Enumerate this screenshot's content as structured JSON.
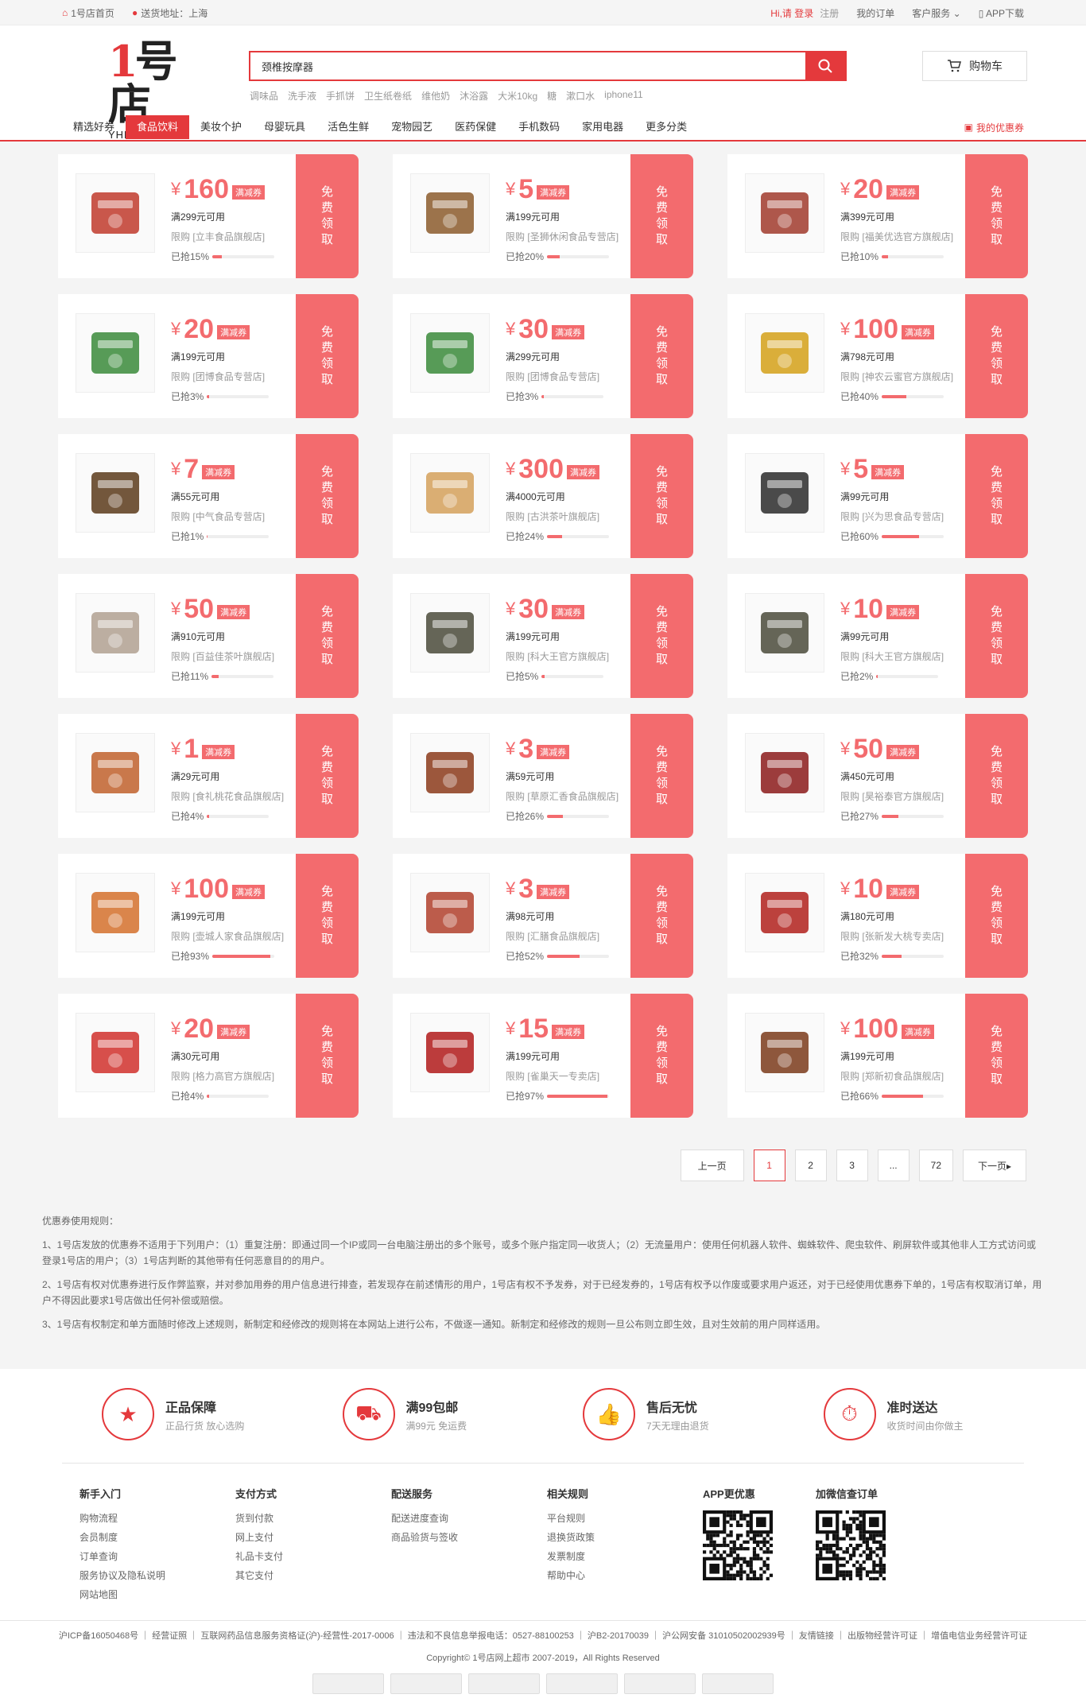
{
  "topbar": {
    "home": "1号店首页",
    "address_label": "送货地址：上海",
    "greeting": "Hi,请 登录",
    "register": "注册",
    "my_orders": "我的订单",
    "service": "客户服务",
    "app": "APP下载"
  },
  "header": {
    "logo_text": "YHD.COM",
    "search_value": "颈椎按摩器",
    "hotwords": [
      "调味品",
      "洗手液",
      "手抓饼",
      "卫生纸卷纸",
      "维他奶",
      "沐浴露",
      "大米10kg",
      "糖",
      "漱口水",
      "iphone11"
    ],
    "cart": "购物车"
  },
  "nav": {
    "items": [
      "精选好券",
      "食品饮料",
      "美妆个护",
      "母婴玩具",
      "活色生鲜",
      "宠物园艺",
      "医药保健",
      "手机数码",
      "家用电器",
      "更多分类"
    ],
    "my_coupons": "我的优惠券"
  },
  "coupon_common": {
    "yen": "¥",
    "tag": "满减券",
    "get_label": [
      "免",
      "费",
      "领",
      "取"
    ],
    "limit_prefix": "限购"
  },
  "coupons": [
    {
      "amount": "160",
      "cond": "满299元可用",
      "store": "[立丰食品旗舰店]",
      "progress": 15,
      "taken": "已抢15%",
      "color": "#c0392b"
    },
    {
      "amount": "5",
      "cond": "满199元可用",
      "store": "[圣狮休闲食品专营店]",
      "progress": 20,
      "taken": "已抢20%",
      "color": "#8b5a2b"
    },
    {
      "amount": "20",
      "cond": "满399元可用",
      "store": "[福美优选官方旗舰店]",
      "progress": 10,
      "taken": "已抢10%",
      "color": "#a0392b"
    },
    {
      "amount": "20",
      "cond": "满199元可用",
      "store": "[团博食品专营店]",
      "progress": 3,
      "taken": "已抢3%",
      "color": "#3a8a3a"
    },
    {
      "amount": "30",
      "cond": "满299元可用",
      "store": "[团博食品专营店]",
      "progress": 3,
      "taken": "已抢3%",
      "color": "#3a8a3a"
    },
    {
      "amount": "100",
      "cond": "满798元可用",
      "store": "[神农云蜜官方旗舰店]",
      "progress": 40,
      "taken": "已抢40%",
      "color": "#d4a017"
    },
    {
      "amount": "7",
      "cond": "满55元可用",
      "store": "[中气食品专营店]",
      "progress": 1,
      "taken": "已抢1%",
      "color": "#5a3a1a"
    },
    {
      "amount": "300",
      "cond": "满4000元可用",
      "store": "[古洪茶叶旗舰店]",
      "progress": 24,
      "taken": "已抢24%",
      "color": "#d4a05a"
    },
    {
      "amount": "5",
      "cond": "满99元可用",
      "store": "[兴为思食品专营店]",
      "progress": 60,
      "taken": "已抢60%",
      "color": "#2a2a2a"
    },
    {
      "amount": "50",
      "cond": "满910元可用",
      "store": "[百益佳茶叶旗舰店]",
      "progress": 11,
      "taken": "已抢11%",
      "color": "#b0a090"
    },
    {
      "amount": "30",
      "cond": "满199元可用",
      "store": "[科大王官方旗舰店]",
      "progress": 5,
      "taken": "已抢5%",
      "color": "#4a4a3a"
    },
    {
      "amount": "10",
      "cond": "满99元可用",
      "store": "[科大王官方旗舰店]",
      "progress": 2,
      "taken": "已抢2%",
      "color": "#4a4a3a"
    },
    {
      "amount": "1",
      "cond": "满29元可用",
      "store": "[食礼桃花食品旗舰店]",
      "progress": 4,
      "taken": "已抢4%",
      "color": "#c0602b"
    },
    {
      "amount": "3",
      "cond": "满59元可用",
      "store": "[草原汇香食品旗舰店]",
      "progress": 26,
      "taken": "已抢26%",
      "color": "#8b3a1a"
    },
    {
      "amount": "50",
      "cond": "满450元可用",
      "store": "[昊裕泰官方旗舰店]",
      "progress": 27,
      "taken": "已抢27%",
      "color": "#8b1a1a"
    },
    {
      "amount": "100",
      "cond": "满199元可用",
      "store": "[壶城人家食品旗舰店]",
      "progress": 93,
      "taken": "已抢93%",
      "color": "#d4702b"
    },
    {
      "amount": "3",
      "cond": "满98元可用",
      "store": "[汇膳食品旗舰店]",
      "progress": 52,
      "taken": "已抢52%",
      "color": "#b0402b"
    },
    {
      "amount": "10",
      "cond": "满180元可用",
      "store": "[张新发大桃专卖店]",
      "progress": 32,
      "taken": "已抢32%",
      "color": "#b0201b"
    },
    {
      "amount": "20",
      "cond": "满30元可用",
      "store": "[格力高官方旗舰店]",
      "progress": 4,
      "taken": "已抢4%",
      "color": "#d0302b"
    },
    {
      "amount": "15",
      "cond": "满199元可用",
      "store": "[雀巢天一专卖店]",
      "progress": 97,
      "taken": "已抢97%",
      "color": "#b01a1a"
    },
    {
      "amount": "100",
      "cond": "满199元可用",
      "store": "[郑新初食品旗舰店]",
      "progress": 66,
      "taken": "已抢66%",
      "color": "#7a3a1a"
    }
  ],
  "pager": {
    "prev": "上一页",
    "pages": [
      "1",
      "2",
      "3",
      "...",
      "72"
    ],
    "next": "下一页▸"
  },
  "rules": {
    "title": "优惠券使用规则：",
    "items": [
      "1、1号店发放的优惠券不适用于下列用户：（1）重复注册：即通过同一个IP或同一台电脑注册出的多个账号，或多个账户指定同一收货人；（2）无流量用户：使用任何机器人软件、蜘蛛软件、爬虫软件、刷屏软件或其他非人工方式访问或登录1号店的用户；（3）1号店判断的其他带有任何恶意目的的用户。",
      "2、1号店有权对优惠券进行反作弊监察，并对参加用券的用户信息进行排查，若发现存在前述情形的用户，1号店有权不予发券，对于已经发券的，1号店有权予以作废或要求用户返还，对于已经使用优惠券下单的，1号店有权取消订单，用户不得因此要求1号店做出任何补偿或赔偿。",
      "3、1号店有权制定和单方面随时修改上述规则，新制定和经修改的规则将在本网站上进行公布，不做逐一通知。新制定和经修改的规则一旦公布则立即生效，且对生效前的用户同样适用。"
    ]
  },
  "promises": [
    {
      "title": "正品保障",
      "sub": "正品行货 放心选购",
      "icon": "award-icon",
      "glyph": "★"
    },
    {
      "title": "满99包邮",
      "sub": "满99元 免运费",
      "icon": "truck-icon",
      "glyph": "⛟"
    },
    {
      "title": "售后无忧",
      "sub": "7天无理由退货",
      "icon": "thumbs-up-icon",
      "glyph": "👍"
    },
    {
      "title": "准时送达",
      "sub": "收货时间由你做主",
      "icon": "stopwatch-icon",
      "glyph": "⏱"
    }
  ],
  "footer_cols": [
    {
      "h": "新手入门",
      "links": [
        "购物流程",
        "会员制度",
        "订单查询",
        "服务协议及隐私说明",
        "网站地图"
      ]
    },
    {
      "h": "支付方式",
      "links": [
        "货到付款",
        "网上支付",
        "礼品卡支付",
        "其它支付"
      ]
    },
    {
      "h": "配送服务",
      "links": [
        "配送进度查询",
        "商品验货与签收"
      ]
    },
    {
      "h": "相关规则",
      "links": [
        "平台规则",
        "退换货政策",
        "发票制度",
        "帮助中心"
      ]
    }
  ],
  "qr": {
    "app": "APP更优惠",
    "wechat": "加微信查订单"
  },
  "icp": {
    "line": "沪ICP备16050468号 ｜ 经营证照 ｜ 互联网药品信息服务资格证(沪)-经营性-2017-0006 ｜ 违法和不良信息举报电话：0527-88100253 ｜ 沪B2-20170039 ｜ 沪公网安备 31010502002939号 ｜ 友情链接 ｜ 出版物经营许可证 ｜ 增值电信业务经营许可证",
    "copyright": "Copyright© 1号店网上超市 2007-2019，All Rights Reserved"
  }
}
